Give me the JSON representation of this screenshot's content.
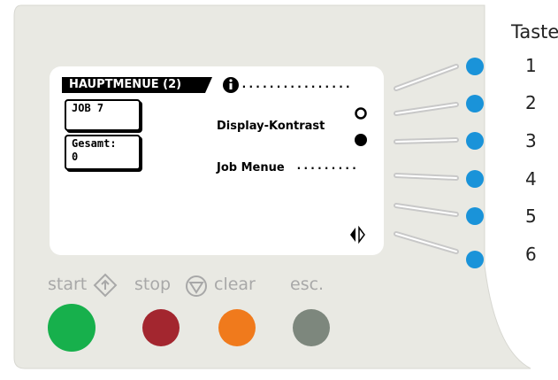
{
  "display": {
    "title": "HAUPTMENUE (2)",
    "job_box": "JOB  7",
    "total_box_label": "Gesamt:",
    "total_box_value": "0",
    "info_dots": "................",
    "contrast_label": "Display-Kontrast",
    "job_menu_label": "Job Menue",
    "job_menu_dots": "........."
  },
  "keys": {
    "heading": "Taste",
    "numbers": [
      "1",
      "2",
      "3",
      "4",
      "5",
      "6"
    ]
  },
  "buttons": {
    "start": "start",
    "stop": "stop",
    "clear": "clear",
    "esc": "esc."
  },
  "colors": {
    "panel": "#e9e9e3",
    "key_blue": "#1a93d9",
    "start": "#17b04c",
    "stop": "#a3262f",
    "clear": "#f07a1c",
    "esc": "#7d877d"
  }
}
